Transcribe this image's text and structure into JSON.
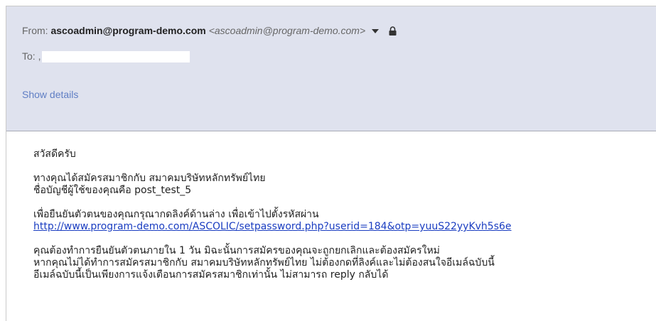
{
  "header": {
    "from_label": "From:",
    "sender": "ascoadmin@program-demo.com",
    "sender_address": "<ascoadmin@program-demo.com>",
    "caret_icon": "chevron-down-icon",
    "lock_icon": "lock-icon",
    "to_label": "To: ,",
    "show_details": "Show details"
  },
  "message": {
    "greeting": "สวัสดีครับ",
    "line1": "ทางคุณได้สมัครสมาชิกกับ สมาคมบริษัทหลักทรัพย์ไทย",
    "line2": "ชื่อบัญชีผู้ใช้ของคุณคือ post_test_5",
    "line3": "เพื่อยืนยันตัวตนของคุณกรุณากดลิงค์ด้านล่าง เพื่อเข้าไปตั้งรหัสผ่าน",
    "link": "http://www.program-demo.com/ASCOLIC/setpassword.php?userid=184&otp=yuuS22yyKvh5s6e",
    "line4": "คุณต้องทำการยืนยันตัวตนภายใน 1 วัน มิฉะนั้นการสมัครของคุณจะถูกยกเลิกและต้องสมัครใหม่",
    "line5": "หากคุณไม่ได้ทำการสมัครสมาชิกกับ สมาคมบริษัทหลักทรัพย์ไทย ไม่ต้องกดที่ลิงค์และไม่ต้องสนใจอีเมล์ฉบับนี้",
    "line6": "อีเมล์ฉบับนี้เป็นเพียงการแจ้งเตือนการสมัครสมาชิกเท่านั้น ไม่สามารถ reply กลับได้"
  },
  "colors": {
    "header_bg": "#dfe2ee",
    "link": "#1a3dc1",
    "show_details": "#5f7ec4"
  }
}
